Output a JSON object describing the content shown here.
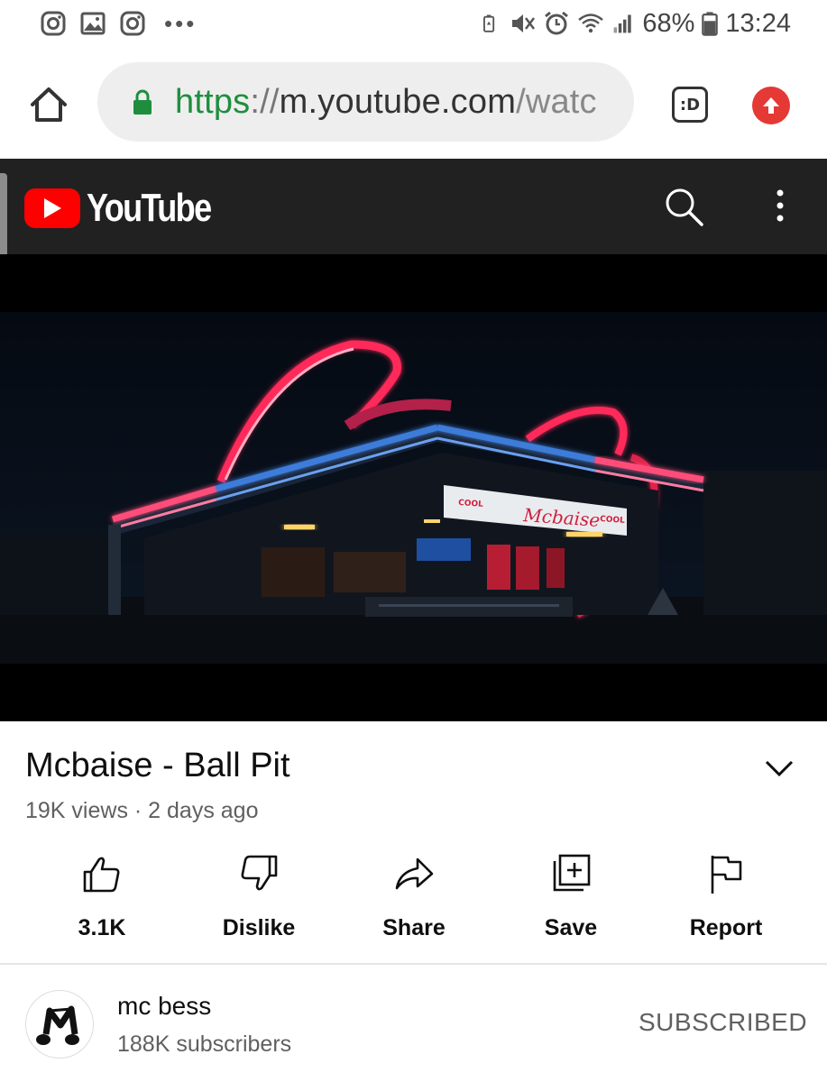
{
  "status_bar": {
    "battery": "68%",
    "time": "13:24",
    "left_icons": [
      "instagram-icon",
      "gallery-icon",
      "instagram-icon",
      "more-dots-icon"
    ],
    "right_icons": [
      "battery-saver-icon",
      "mute-icon",
      "alarm-icon",
      "wifi-icon",
      "signal-icon",
      "battery-icon"
    ]
  },
  "browser": {
    "url_scheme": "https",
    "url_sep": "://",
    "url_host": "m.youtube.com",
    "url_path": "/watc",
    "extension_label": ":D"
  },
  "youtube": {
    "logo_text": "YouTube",
    "brand_color": "#ff0000"
  },
  "video": {
    "title": "Mcbaise - Ball Pit",
    "meta": "19K views · 2 days ago",
    "thumbnail_sign_text": "Mcbaise",
    "thumbnail_small_text": "COOL"
  },
  "actions": [
    {
      "label": "3.1K",
      "icon": "thumbs-up-icon"
    },
    {
      "label": "Dislike",
      "icon": "thumbs-down-icon"
    },
    {
      "label": "Share",
      "icon": "share-icon"
    },
    {
      "label": "Save",
      "icon": "save-to-playlist-icon"
    },
    {
      "label": "Report",
      "icon": "flag-icon"
    }
  ],
  "channel": {
    "name": "mc bess",
    "subscribers": "188K subscribers",
    "subscribe_label": "SUBSCRIBED"
  }
}
